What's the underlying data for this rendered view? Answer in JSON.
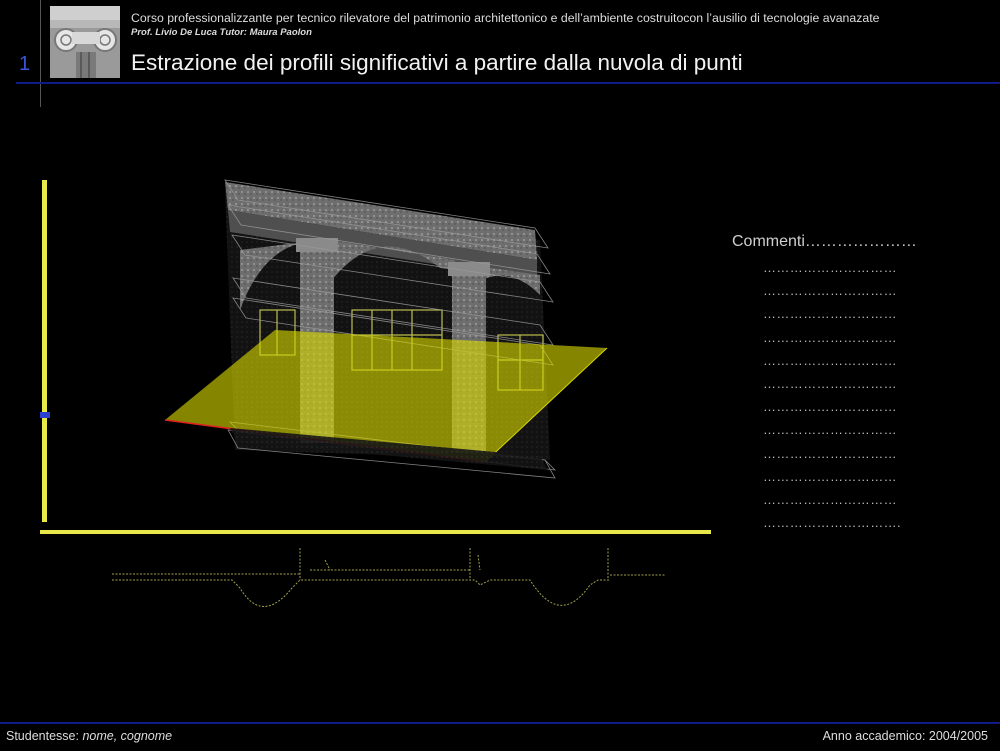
{
  "header": {
    "course": "Corso professionalizzante per  tecnico rilevatore del patrimonio architettonico e dell’ambiente costruitocon l’ausilio di tecnologie avanazate",
    "prof": "Prof. Livio De Luca  Tutor: Maura Paolon"
  },
  "slide": {
    "number": "1",
    "title": "Estrazione dei profili significativi a partire dalla nuvola di punti"
  },
  "comments": {
    "title": "Commenti…………………",
    "lines": [
      "…………………………",
      "…………………………",
      "…………………………",
      "…………………………",
      "…………………………",
      "…………………………",
      "…………………………",
      "…………………………",
      "…………………………",
      "…………………………",
      "…………………………",
      "…………………………."
    ]
  },
  "footer": {
    "students_label": "Studentesse:",
    "students_value": "nome, cognome",
    "year": "Anno accademico: 2004/2005"
  },
  "colors": {
    "background": "#000000",
    "rule_blue": "#101a8a",
    "slide_number": "#3a55d8",
    "section_plane": "#d6d600",
    "section_edge": "#e02020",
    "axis_yellow": "#e8e84a"
  },
  "icons": {
    "header_thumbnail": "ionic-capital-photo"
  }
}
